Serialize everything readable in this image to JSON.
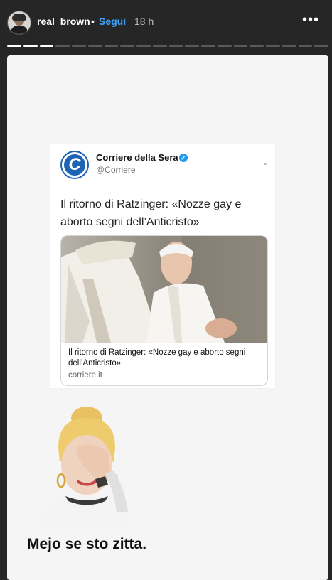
{
  "header": {
    "username": "real_brown",
    "separator": "•",
    "follow_label": "Segui",
    "time_ago": "18 h",
    "more_icon": "more-horizontal-icon"
  },
  "progress": {
    "total_segments": 20,
    "completed_segments": 3
  },
  "tweet": {
    "account_name": "Corriere della Sera",
    "logo_letter": "C",
    "verified_mark": "✓",
    "handle": "@Corriere",
    "text": "Il ritorno di Ratzinger: «Nozze gay e aborto segni dell’Anticristo»",
    "card_title": "Il ritorno di Ratzinger: «Nozze gay e aborto segni dell’Anticristo»",
    "card_url": "corriere.it"
  },
  "caption": "Mejo se sto zitta.",
  "colors": {
    "background": "#262626",
    "story": "#f5f5f5",
    "follow": "#3ea6ff",
    "verified": "#1d9bf0",
    "logo": "#1e64b4"
  }
}
